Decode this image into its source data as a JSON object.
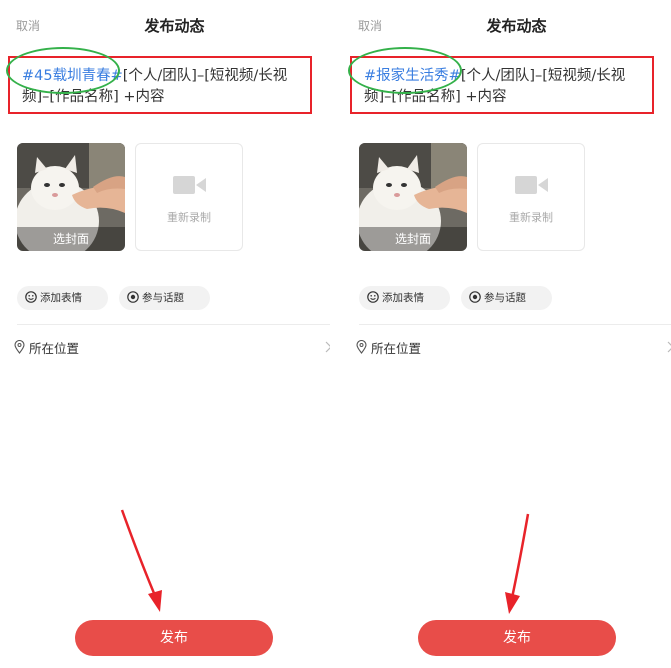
{
  "panels": [
    {
      "cancel_label": "取消",
      "title": "发布动态",
      "hashtag": "#45载圳青春#",
      "caption_rest": "[个人/团队]–[短视频/长视频]–[作品名称] +内容",
      "cover_label": "选封面",
      "rerecord_label": "重新录制",
      "emoji_label": "添加表情",
      "topic_label": "参与话题",
      "location_label": "所在位置",
      "publish_label": "发布"
    },
    {
      "cancel_label": "取消",
      "title": "发布动态",
      "hashtag": "#报家生活秀#",
      "caption_rest": "[个人/团队]–[短视频/长视频]–[作品名称] +内容",
      "cover_label": "选封面",
      "rerecord_label": "重新录制",
      "emoji_label": "添加表情",
      "topic_label": "参与话题",
      "location_label": "所在位置",
      "publish_label": "发布"
    }
  ],
  "colors": {
    "accent": "#e84d49",
    "highlight_box": "#e8232a",
    "highlight_ellipse": "#34b14a",
    "hashtag": "#3a7ee0"
  },
  "icons": [
    "smile-icon",
    "topic-icon",
    "video-camera-icon",
    "location-pin-icon",
    "chevron-right-icon"
  ]
}
